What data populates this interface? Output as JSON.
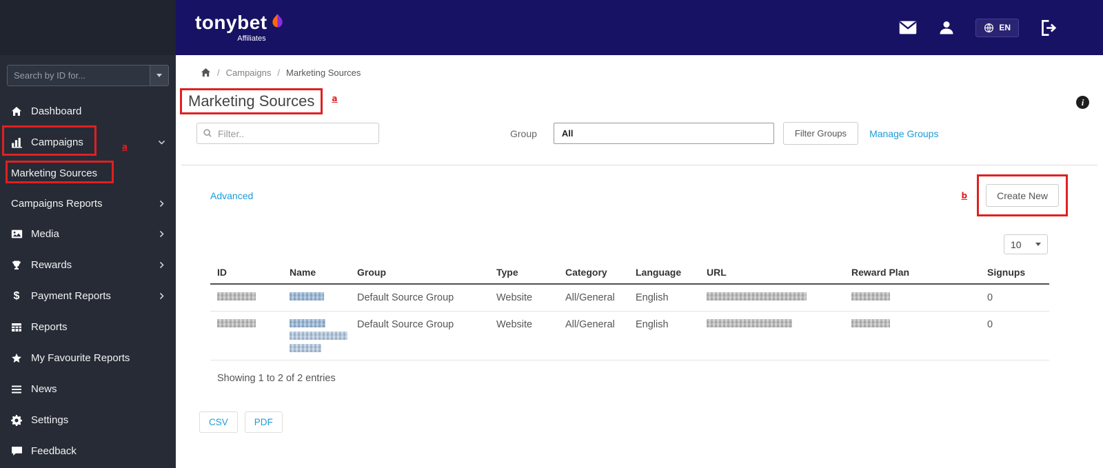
{
  "topbar": {
    "brand": "tonybet",
    "brand_sub": "Affiliates",
    "lang": "EN"
  },
  "sidebar": {
    "search_placeholder": "Search by ID for...",
    "items": [
      "Dashboard",
      "Campaigns",
      "Marketing Sources",
      "Campaigns Reports",
      "Media",
      "Rewards",
      "Payment Reports",
      "Reports",
      "My Favourite Reports",
      "News",
      "Settings",
      "Feedback"
    ]
  },
  "breadcrumb": {
    "sep": "/",
    "items": [
      "Campaigns",
      "Marketing Sources"
    ]
  },
  "page": {
    "title": "Marketing Sources"
  },
  "annotations": {
    "a_sidebar": "a",
    "a_title": "a",
    "b_create": "b"
  },
  "filters": {
    "placeholder": "Filter..",
    "group_label": "Group",
    "group_value": "All",
    "filter_groups_button": "Filter Groups",
    "manage_groups_link": "Manage Groups"
  },
  "toolbar": {
    "advanced_link": "Advanced",
    "create_new_button": "Create New",
    "page_size": "10"
  },
  "table": {
    "columns": [
      "ID",
      "Name",
      "Group",
      "Type",
      "Category",
      "Language",
      "URL",
      "Reward Plan",
      "Signups"
    ],
    "rows": [
      {
        "group": "Default Source Group",
        "type": "Website",
        "category": "All/General",
        "language": "English",
        "signups": "0"
      },
      {
        "group": "Default Source Group",
        "type": "Website",
        "category": "All/General",
        "language": "English",
        "signups": "0"
      }
    ],
    "summary": "Showing 1 to 2 of 2 entries"
  },
  "export": {
    "csv": "CSV",
    "pdf": "PDF"
  },
  "colors": {
    "topbar": "#181264",
    "sidebar": "#262b36",
    "link": "#1d9bd8",
    "annotation": "#e02020"
  }
}
